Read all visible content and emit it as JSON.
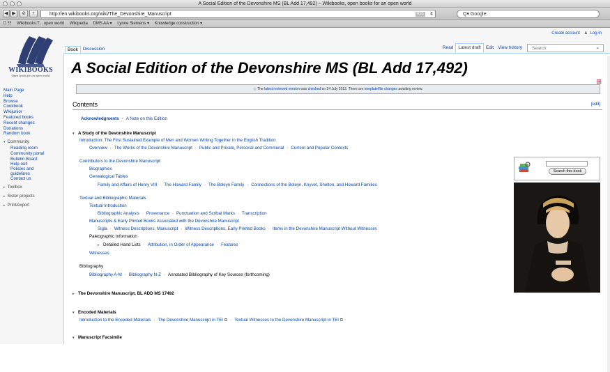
{
  "browser": {
    "title": "A Social Edition of the Devonshire MS (BL Add 17,492) – Wikibooks, open books for an open world",
    "url": "http://en.wikibooks.org/wiki/The_Devonshire_Manuscript",
    "rss": "RSS",
    "search_placeholder": "Q▾ Google",
    "bookmarks": [
      "Wikibooks:T... open world",
      "Wikipedia",
      "DMS AA ▾",
      "Lynne Siemens ▾",
      "Knowledge construction ▾"
    ]
  },
  "site": {
    "logo_name": "WIKIBOOKS",
    "logo_tagline": "Open books for an open world"
  },
  "user": {
    "create_account": "Create account",
    "login": "Log in"
  },
  "sidebar": {
    "main": [
      "Main Page",
      "Help",
      "Browse",
      "Cookbook",
      "Wikijunior",
      "Featured books",
      "Recent changes",
      "Donations",
      "Random book"
    ],
    "community_label": "Community",
    "community": [
      "Reading room",
      "Community portal",
      "Bulletin Board",
      "Help out!",
      "Policies and guidelines",
      "Contact us"
    ],
    "toolbox": "Toolbox",
    "sister": "Sister projects",
    "printexport": "Print/export"
  },
  "tabs": {
    "left": [
      "Book",
      "Discussion"
    ],
    "right": [
      "Read",
      "Latest draft",
      "Edit",
      "View history"
    ],
    "search_placeholder": "Search"
  },
  "page": {
    "title": "A Social Edition of the Devonshire MS (BL Add 17,492)",
    "flag_prefix": "The ",
    "flag_link1": "latest reviewed version",
    "flag_mid": " was ",
    "flag_link2": "checked",
    "flag_date": " on 24 July 2012. There are ",
    "flag_link3": "template/file changes",
    "flag_suffix": " awaiting review.",
    "contents_heading": "Contents",
    "edit": "[edit]"
  },
  "toc": {
    "ack": "Acknowledgments",
    "note": "A Note on this Edition",
    "study": "A Study of the Devonshire Manuscript",
    "intro": "Introduction: The First Sustained Example of Men and Women Writing Together in the English Tradition",
    "intro_sub": [
      "Overview",
      "The Works of the Devonshire Manuscript",
      "Public and Private, Personal and Communal",
      "Current and Popular Contexts"
    ],
    "contributors": "Contributors to the Devonshire Manuscript",
    "bios": "Biographies",
    "genealogical": "Genealogical Tables",
    "families": [
      "Family and Affairs of Henry VIII",
      "The Howard Family",
      "The Boleyn Family",
      "Connections of the Boleyn, Knyvet, Shelton, and Howard Families"
    ],
    "textual": "Textual and Bibliographic Materials",
    "textual_intro": "Textual Introduction",
    "textual_intro_sub": [
      "Bibliographic Analysis",
      "Provenance",
      "Punctuation and Scribal Marks",
      "Transcription"
    ],
    "manuscripts": "Manuscripts & Early Printed Books Associated with the Devonshire Manuscript",
    "manuscripts_sub": [
      "Sigla",
      "Witness Descriptions, Manuscript",
      "Witness Descriptions, Early Printed Books",
      "Items in the Devonshire Manuscript Without Witnesses"
    ],
    "paleo": "Paleographic Information",
    "paleo_sub": [
      "Detailed Hand Lists",
      "Attribution, in Order of Appearance",
      "Features"
    ],
    "witnesses": "Witnesses",
    "biblio": "Bibliography",
    "biblio_sub": [
      "Bibliography A-M",
      "Bibliography N-Z"
    ],
    "biblio_annot": "Annotated Bibliography of Key Sources (forthcoming)",
    "devms": "The Devonshire Manuscript, BL ADD MS 17492",
    "encoded": "Encoded Materials",
    "encoded_sub": [
      "Introduction to the Encoded Materials",
      "The Devonshire Manuscript in TEI",
      "Textual Witnesses to the Devonshire Manuscript in TEI"
    ],
    "facsimile": "Manuscript Facsimile"
  },
  "searchbook": {
    "button": "Search this book"
  }
}
